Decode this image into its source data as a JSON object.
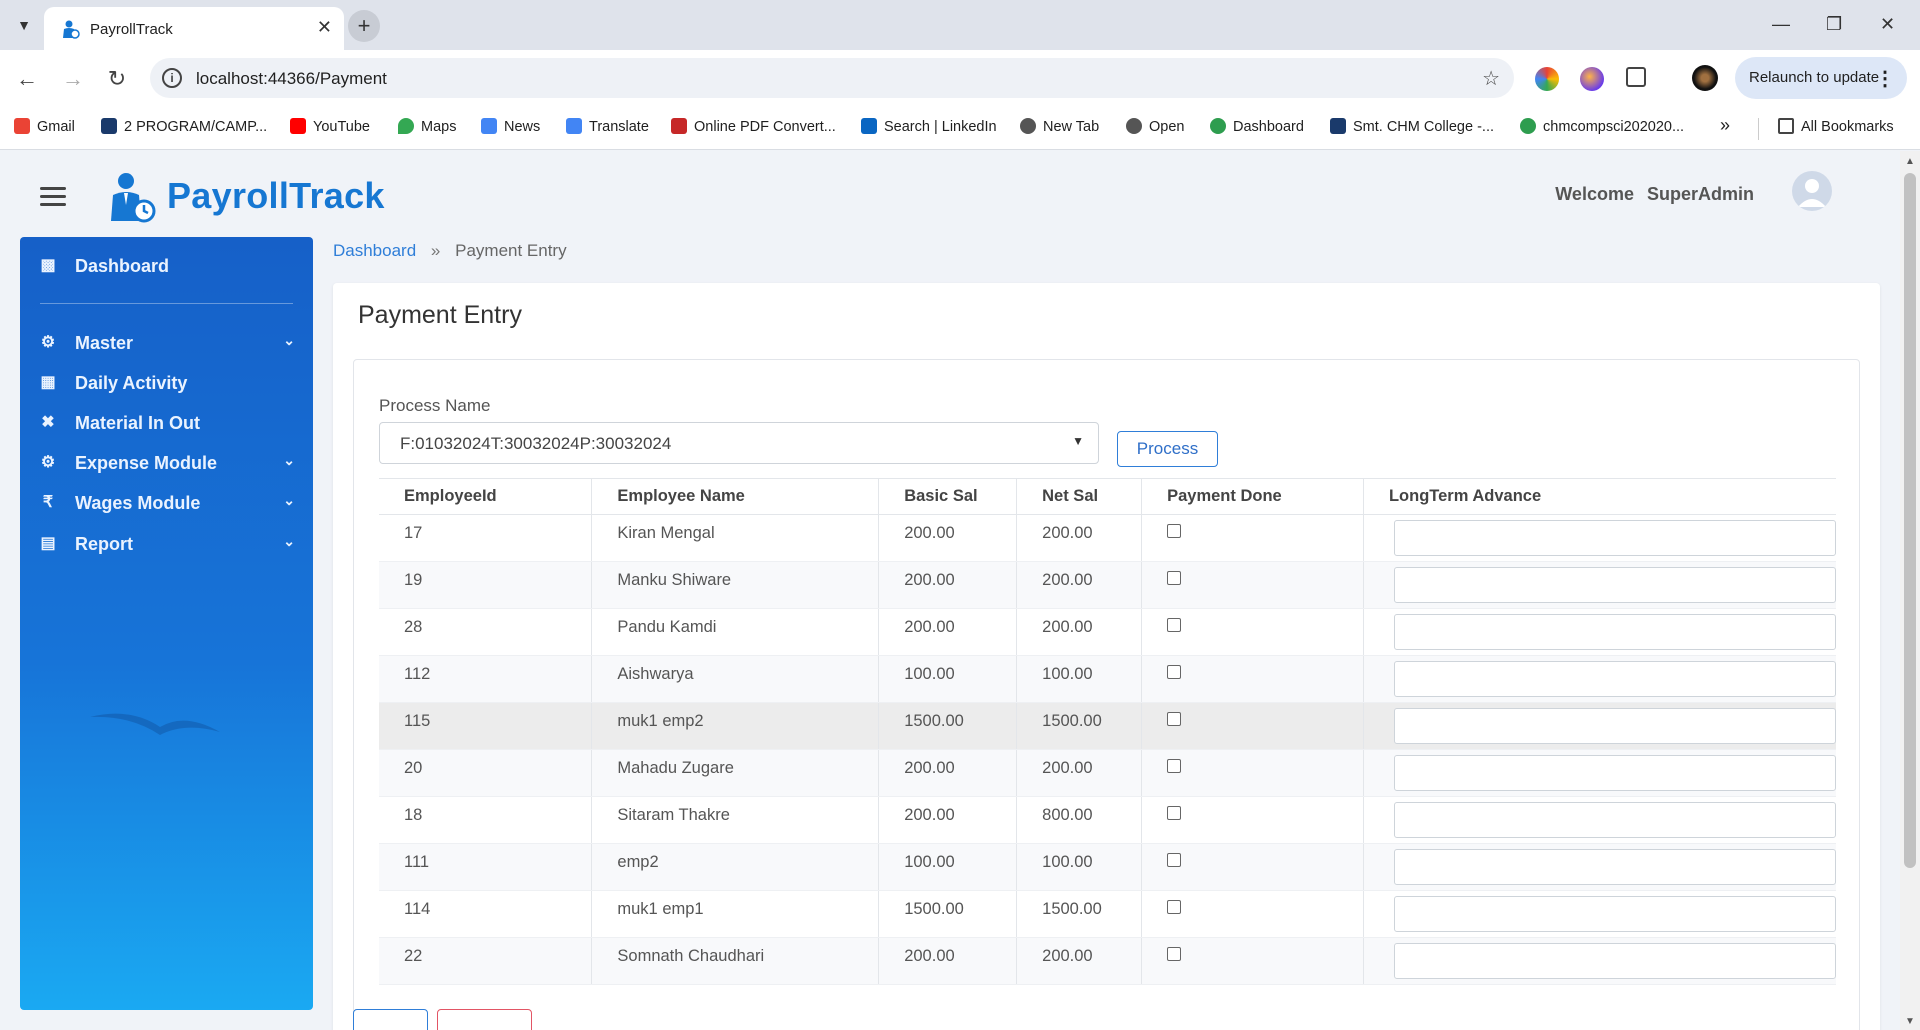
{
  "browser": {
    "tab_title": "PayrollTrack",
    "url": "localhost:44366/Payment",
    "relaunch_label": "Relaunch to update",
    "bookmarks": [
      {
        "label": "Gmail",
        "icon": "gmail-icon",
        "color": "#ea4335"
      },
      {
        "label": "2 PROGRAM/CAMP...",
        "icon": "a-logo-icon",
        "color": "#1a3a6b"
      },
      {
        "label": "YouTube",
        "icon": "youtube-icon",
        "color": "#ff0000"
      },
      {
        "label": "Maps",
        "icon": "maps-icon",
        "color": "#34a853"
      },
      {
        "label": "News",
        "icon": "news-icon",
        "color": "#4285f4"
      },
      {
        "label": "Translate",
        "icon": "translate-icon",
        "color": "#4285f4"
      },
      {
        "label": "Online PDF Convert...",
        "icon": "pdf-icon",
        "color": "#c62828"
      },
      {
        "label": "Search | LinkedIn",
        "icon": "linkedin-icon",
        "color": "#0a66c2"
      },
      {
        "label": "New Tab",
        "icon": "globe-icon",
        "color": "#555555"
      },
      {
        "label": "Open",
        "icon": "globe-icon",
        "color": "#555555"
      },
      {
        "label": "Dashboard",
        "icon": "earth-icon",
        "color": "#2e9d4f"
      },
      {
        "label": "Smt. CHM College -...",
        "icon": "a-logo-icon",
        "color": "#1a3a6b"
      },
      {
        "label": "chmcompsci202020...",
        "icon": "earth-icon",
        "color": "#2e9d4f"
      }
    ],
    "bookmarks_overflow": "»",
    "all_bookmarks_label": "All Bookmarks"
  },
  "app": {
    "brand": "PayrollTrack",
    "welcome_label": "Welcome",
    "user_name": "SuperAdmin",
    "accent": "#1677d2"
  },
  "sidebar": {
    "items": [
      {
        "label": "Dashboard",
        "icon": "chart-bar-icon",
        "chevron": false
      },
      {
        "label": "Master",
        "icon": "gear-icon",
        "chevron": true
      },
      {
        "label": "Daily Activity",
        "icon": "calendar-icon",
        "chevron": false
      },
      {
        "label": "Material In Out",
        "icon": "tools-icon",
        "chevron": false
      },
      {
        "label": "Expense Module",
        "icon": "gear-icon",
        "chevron": true
      },
      {
        "label": "Wages Module",
        "icon": "rupee-icon",
        "chevron": true
      },
      {
        "label": "Report",
        "icon": "report-icon",
        "chevron": true
      }
    ]
  },
  "breadcrumb": {
    "home": "Dashboard",
    "separator": "»",
    "current": "Payment Entry"
  },
  "payment": {
    "title": "Payment Entry",
    "process_label": "Process Name",
    "process_value": "F:01032024T:30032024P:30032024",
    "process_button": "Process",
    "columns": [
      "EmployeeId",
      "Employee Name",
      "Basic Sal",
      "Net Sal",
      "Payment Done",
      "LongTerm Advance"
    ],
    "rows": [
      {
        "id": "17",
        "name": "Kiran Mengal",
        "basic": "200.00",
        "net": "200.00",
        "paid": false,
        "advance": ""
      },
      {
        "id": "19",
        "name": "Manku Shiware",
        "basic": "200.00",
        "net": "200.00",
        "paid": false,
        "advance": ""
      },
      {
        "id": "28",
        "name": "Pandu Kamdi",
        "basic": "200.00",
        "net": "200.00",
        "paid": false,
        "advance": ""
      },
      {
        "id": "112",
        "name": "Aishwarya",
        "basic": "100.00",
        "net": "100.00",
        "paid": false,
        "advance": ""
      },
      {
        "id": "115",
        "name": "muk1 emp2",
        "basic": "1500.00",
        "net": "1500.00",
        "paid": false,
        "advance": ""
      },
      {
        "id": "20",
        "name": "Mahadu Zugare",
        "basic": "200.00",
        "net": "200.00",
        "paid": false,
        "advance": ""
      },
      {
        "id": "18",
        "name": "Sitaram Thakre",
        "basic": "200.00",
        "net": "800.00",
        "paid": false,
        "advance": ""
      },
      {
        "id": "111",
        "name": "emp2",
        "basic": "100.00",
        "net": "100.00",
        "paid": false,
        "advance": ""
      },
      {
        "id": "114",
        "name": "muk1 emp1",
        "basic": "1500.00",
        "net": "1500.00",
        "paid": false,
        "advance": ""
      },
      {
        "id": "22",
        "name": "Somnath Chaudhari",
        "basic": "200.00",
        "net": "200.00",
        "paid": false,
        "advance": ""
      }
    ]
  }
}
